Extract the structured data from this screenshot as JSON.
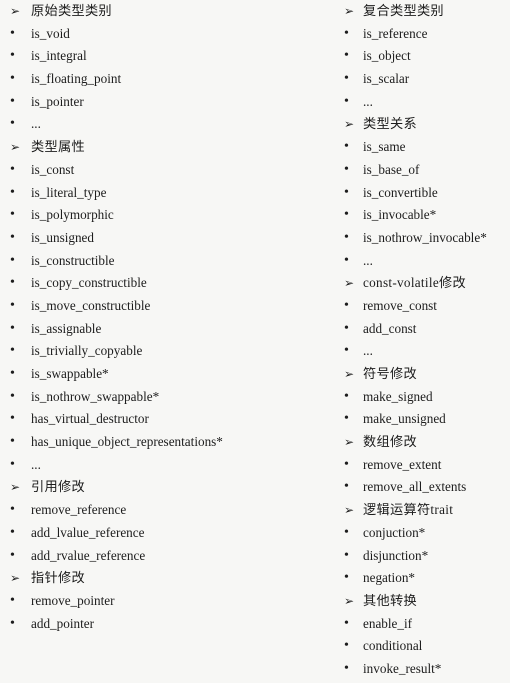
{
  "glyphs": {
    "arrow": "➢",
    "bullet": "•"
  },
  "left_column": [
    {
      "kind": "heading",
      "text": "原始类型类别"
    },
    {
      "kind": "item",
      "text": "is_void"
    },
    {
      "kind": "item",
      "text": "is_integral"
    },
    {
      "kind": "item",
      "text": "is_floating_point"
    },
    {
      "kind": "item",
      "text": "is_pointer"
    },
    {
      "kind": "item",
      "text": "..."
    },
    {
      "kind": "heading",
      "text": "类型属性"
    },
    {
      "kind": "item",
      "text": "is_const"
    },
    {
      "kind": "item",
      "text": "is_literal_type"
    },
    {
      "kind": "item",
      "text": "is_polymorphic"
    },
    {
      "kind": "item",
      "text": "is_unsigned"
    },
    {
      "kind": "item",
      "text": "is_constructible"
    },
    {
      "kind": "item",
      "text": "is_copy_constructible"
    },
    {
      "kind": "item",
      "text": "is_move_constructible"
    },
    {
      "kind": "item",
      "text": "is_assignable"
    },
    {
      "kind": "item",
      "text": "is_trivially_copyable"
    },
    {
      "kind": "item",
      "text": "is_swappable*"
    },
    {
      "kind": "item",
      "text": "is_nothrow_swappable*"
    },
    {
      "kind": "item",
      "text": "has_virtual_destructor"
    },
    {
      "kind": "item",
      "text": "has_unique_object_representations*"
    },
    {
      "kind": "item",
      "text": "..."
    },
    {
      "kind": "heading",
      "text": "引用修改"
    },
    {
      "kind": "item",
      "text": "remove_reference"
    },
    {
      "kind": "item",
      "text": "add_lvalue_reference"
    },
    {
      "kind": "item",
      "text": "add_rvalue_reference"
    },
    {
      "kind": "heading",
      "text": "指针修改"
    },
    {
      "kind": "item",
      "text": "remove_pointer"
    },
    {
      "kind": "item",
      "text": "add_pointer"
    }
  ],
  "right_column": [
    {
      "kind": "heading",
      "text": "复合类型类别"
    },
    {
      "kind": "item",
      "text": "is_reference"
    },
    {
      "kind": "item",
      "text": "is_object"
    },
    {
      "kind": "item",
      "text": "is_scalar"
    },
    {
      "kind": "item",
      "text": "..."
    },
    {
      "kind": "heading",
      "text": "类型关系"
    },
    {
      "kind": "item",
      "text": "is_same"
    },
    {
      "kind": "item",
      "text": "is_base_of"
    },
    {
      "kind": "item",
      "text": "is_convertible"
    },
    {
      "kind": "item",
      "text": "is_invocable*"
    },
    {
      "kind": "item",
      "text": "is_nothrow_invocable*"
    },
    {
      "kind": "item",
      "text": "..."
    },
    {
      "kind": "heading",
      "text": "const-volatile修改"
    },
    {
      "kind": "item",
      "text": "remove_const"
    },
    {
      "kind": "item",
      "text": "add_const"
    },
    {
      "kind": "item",
      "text": "..."
    },
    {
      "kind": "heading",
      "text": "符号修改"
    },
    {
      "kind": "item",
      "text": "make_signed"
    },
    {
      "kind": "item",
      "text": "make_unsigned"
    },
    {
      "kind": "heading",
      "text": "数组修改"
    },
    {
      "kind": "item",
      "text": "remove_extent"
    },
    {
      "kind": "item",
      "text": "remove_all_extents"
    },
    {
      "kind": "heading",
      "text": "逻辑运算符trait"
    },
    {
      "kind": "item",
      "text": "conjuction*"
    },
    {
      "kind": "item",
      "text": "disjunction*"
    },
    {
      "kind": "item",
      "text": "negation*"
    },
    {
      "kind": "heading",
      "text": "其他转换"
    },
    {
      "kind": "item",
      "text": "enable_if"
    },
    {
      "kind": "item",
      "text": "conditional"
    },
    {
      "kind": "item",
      "text": "invoke_result*"
    }
  ]
}
